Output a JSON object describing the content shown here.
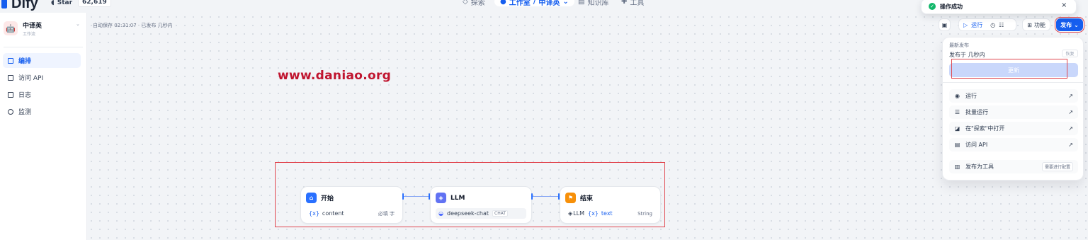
{
  "header": {
    "brand": "Dify",
    "star_label": "Star",
    "star_count": "62,619",
    "nav": [
      {
        "label": "探索"
      },
      {
        "label": "工作室"
      },
      {
        "label": "中译英"
      },
      {
        "label": "知识库"
      },
      {
        "label": "工具"
      }
    ]
  },
  "toast": {
    "message": "操作成功"
  },
  "app": {
    "name": "中译英",
    "type": "工作流"
  },
  "sidebar": {
    "items": [
      {
        "label": "编排"
      },
      {
        "label": "访问 API"
      },
      {
        "label": "日志"
      },
      {
        "label": "监测"
      }
    ]
  },
  "autosave": "自动保存 02:31:07 · 已发布 几秒内",
  "watermark": "www.daniao.org",
  "toolbar": {
    "run_label": "运行",
    "features_label": "功能",
    "publish_label": "发布"
  },
  "publish_menu": {
    "latest_label": "最新发布",
    "published_at": "发布于 几秒内",
    "restore_label": "恢复",
    "update_label": "更新",
    "items": [
      {
        "label": "运行"
      },
      {
        "label": "批量运行"
      },
      {
        "label": "在\"探索\"中打开"
      },
      {
        "label": "访问 API"
      }
    ],
    "publish_as_tool": "发布为工具",
    "tool_config_badge": "需要进行配置"
  },
  "workflow": {
    "start": {
      "title": "开始",
      "var": "{x}",
      "var_name": "content",
      "required": "必填",
      "type": "字"
    },
    "llm": {
      "title": "LLM",
      "model": "deepseek-chat",
      "mode": "CHAT"
    },
    "end": {
      "title": "结束",
      "source": "LLM",
      "var": "{x}",
      "var_name": "text",
      "type": "String"
    }
  }
}
